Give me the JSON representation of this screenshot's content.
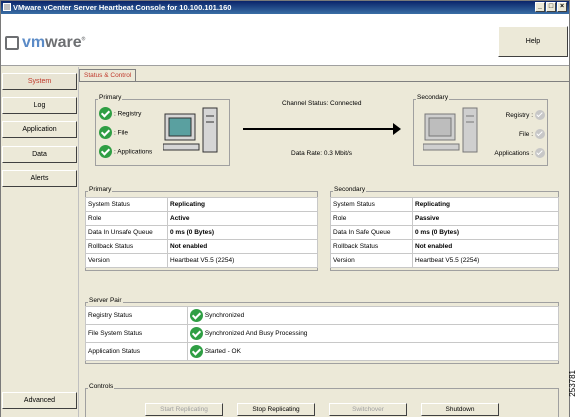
{
  "window": {
    "title": "VMware vCenter Server Heartbeat Console for 10.100.101.160",
    "min": "_",
    "max": "□",
    "close": "×"
  },
  "header": {
    "logo_text_vm": "vm",
    "logo_text_ware": "ware",
    "logo_reg": "®",
    "help_label": "Help"
  },
  "nav": {
    "items": [
      "System",
      "Log",
      "Application",
      "Data",
      "Alerts"
    ],
    "advanced": "Advanced"
  },
  "tab": {
    "label": "Status & Control"
  },
  "primary_box": {
    "title": "Primary",
    "items": [
      ": Registry",
      ": File",
      ": Applications"
    ]
  },
  "channel": {
    "status": "Channel Status: Connected",
    "rate": "Data Rate: 0.3 Mbit/s"
  },
  "secondary_box": {
    "title": "Secondary",
    "items": [
      "Registry :",
      "File :",
      "Applications :"
    ]
  },
  "primary_table": {
    "title": "Primary",
    "rows": [
      [
        "System Status",
        "Replicating"
      ],
      [
        "Role",
        "Active"
      ],
      [
        "Data In Unsafe Queue",
        "0 ms (0 Bytes)"
      ],
      [
        "Rollback Status",
        "Not enabled"
      ],
      [
        "Version",
        "Heartbeat V5.5 (2254)"
      ]
    ]
  },
  "secondary_table": {
    "title": "Secondary",
    "rows": [
      [
        "System Status",
        "Replicating"
      ],
      [
        "Role",
        "Passive"
      ],
      [
        "Data In Safe Queue",
        "0 ms (0 Bytes)"
      ],
      [
        "Rollback Status",
        "Not enabled"
      ],
      [
        "Version",
        "Heartbeat V5.5 (2254)"
      ]
    ]
  },
  "server_pair": {
    "title": "Server Pair",
    "rows": [
      [
        "Registry Status",
        "Synchronized"
      ],
      [
        "File System Status",
        "Synchronized And Busy Processing"
      ],
      [
        "Application Status",
        "Started - OK"
      ]
    ]
  },
  "controls": {
    "title": "Controls",
    "buttons": [
      "Start Replicating",
      "Stop Replicating",
      "Switchover",
      "Shutdown"
    ]
  },
  "figure_number": "253781"
}
